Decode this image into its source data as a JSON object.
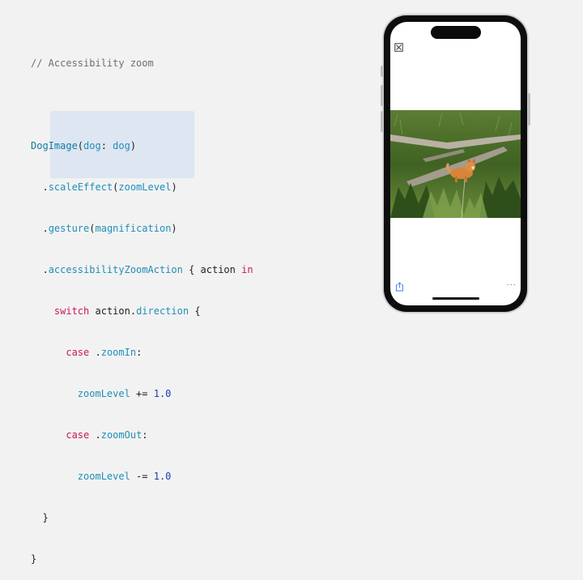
{
  "code": {
    "comment": "// Accessibility zoom",
    "line1": {
      "type": "DogImage",
      "p1": "(",
      "param": "dog",
      "p2": ": ",
      "arg": "dog",
      "p3": ")"
    },
    "line2": {
      "dot": ".",
      "method": "scaleEffect",
      "p1": "(",
      "arg": "zoomLevel",
      "p2": ")"
    },
    "line3": {
      "dot": ".",
      "method": "gesture",
      "p1": "(",
      "arg": "magnification",
      "p2": ")"
    },
    "line4": {
      "dot": ".",
      "method": "accessibilityZoomAction",
      "p1": " { action ",
      "kw": "in"
    },
    "line5": {
      "kw": "switch",
      "p1": " action.",
      "member": "direction",
      "p2": " {"
    },
    "line6": {
      "kw": "case",
      "p1": " .",
      "member": "zoomIn",
      "p2": ":"
    },
    "line7": {
      "var": "zoomLevel",
      "op": " += ",
      "num": "1.0"
    },
    "line8": {
      "kw": "case",
      "p1": " .",
      "member": "zoomOut",
      "p2": ":"
    },
    "line9": {
      "var": "zoomLevel",
      "op": " -= ",
      "num": "1.0"
    },
    "line10": "}",
    "line11": "}"
  },
  "phone": {
    "more_label": "···",
    "icons": [
      "close-icon",
      "share-icon",
      "more-icon"
    ]
  },
  "colors": {
    "keyword": "#c8195c",
    "type": "#0f7aa3",
    "number": "#1b3fae",
    "highlight": "#dde6f1",
    "accent": "#3479f6"
  }
}
